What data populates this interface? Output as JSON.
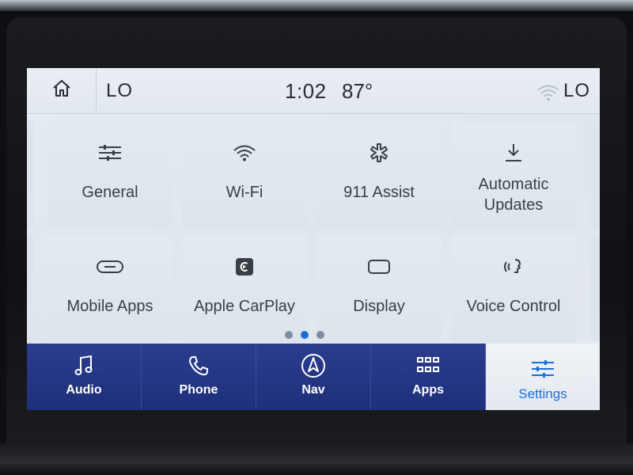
{
  "status_bar": {
    "left_temp": "LO",
    "time": "1:02",
    "outside_temp": "87°",
    "right_temp": "LO"
  },
  "tiles": [
    {
      "label_lines": [
        "General"
      ],
      "icon": "sliders-icon"
    },
    {
      "label_lines": [
        "Wi-Fi"
      ],
      "icon": "wifi-icon"
    },
    {
      "label_lines": [
        "911 Assist"
      ],
      "icon": "star-of-life-icon"
    },
    {
      "label_lines": [
        "Automatic",
        "Updates"
      ],
      "icon": "download-icon"
    },
    {
      "label_lines": [
        "Mobile Apps"
      ],
      "icon": "link-icon"
    },
    {
      "label_lines": [
        "Apple CarPlay"
      ],
      "icon": "carplay-icon"
    },
    {
      "label_lines": [
        "Display"
      ],
      "icon": "display-icon"
    },
    {
      "label_lines": [
        "Voice Control"
      ],
      "icon": "voice-icon"
    }
  ],
  "pager": {
    "pages": 3,
    "active": 1
  },
  "bottom_nav": [
    {
      "label": "Audio",
      "icon": "music-note-icon",
      "active": false
    },
    {
      "label": "Phone",
      "icon": "phone-icon",
      "active": false
    },
    {
      "label": "Nav",
      "icon": "compass-icon",
      "active": false
    },
    {
      "label": "Apps",
      "icon": "grid-icon",
      "active": false
    },
    {
      "label": "Settings",
      "icon": "settings-sliders-icon",
      "active": true
    }
  ],
  "colors": {
    "accent": "#1c6fd6",
    "nav_background": "#24358a",
    "screen_background": "#e2e8ef",
    "text": "#3a3f47"
  }
}
